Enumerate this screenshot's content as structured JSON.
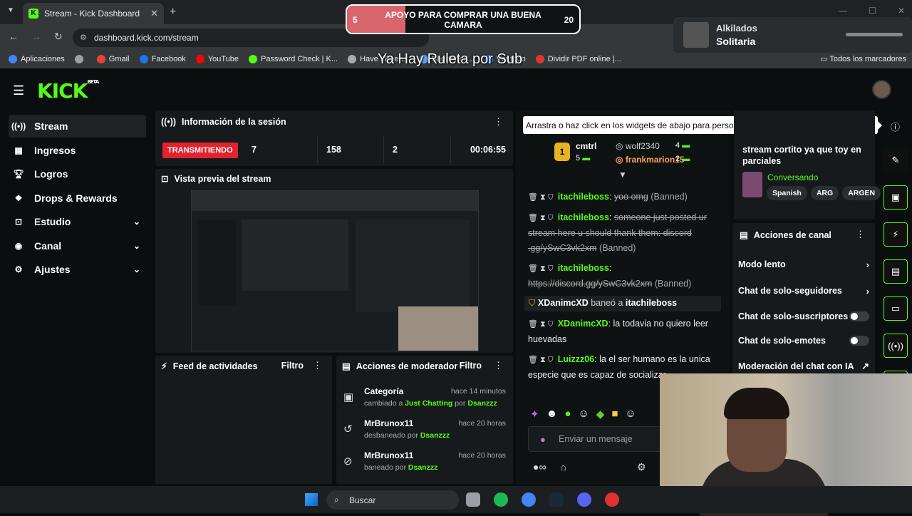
{
  "browser": {
    "tab_title": "Stream - Kick Dashboard",
    "url": "dashboard.kick.com/stream",
    "bookmarks": [
      {
        "label": "Aplicaciones",
        "color": "#4285f4"
      },
      {
        "label": "",
        "color": "#9aa0a6"
      },
      {
        "label": "Gmail",
        "color": "#ea4335"
      },
      {
        "label": "Facebook",
        "color": "#1877f2"
      },
      {
        "label": "YouTube",
        "color": "#ff0000"
      },
      {
        "label": "Password Check | K...",
        "color": "#53fc18"
      },
      {
        "label": "Have I Been...",
        "color": "#aaaaaa"
      },
      {
        "label": "Shortened...",
        "color": "#5fa0ff"
      },
      {
        "label": "Ver todo",
        "color": "#1877f2"
      },
      {
        "label": "Dividir PDF online |...",
        "color": "#e5322d"
      }
    ],
    "all_bookmarks": "Todos los marcadores"
  },
  "overlay": {
    "goal_left": "5",
    "goal_text": "APOYO PARA COMPRAR UNA BUENA CAMARA",
    "goal_right": "20",
    "goal_progress": 0.25,
    "ruleta": "Ya Hay Ruleta por Sub",
    "spotify_line1": "Alkilados",
    "spotify_line2": "Solitaria"
  },
  "sidebar": {
    "items": [
      {
        "label": "Stream",
        "icon": "stream-icon",
        "glyph": "((•))",
        "active": true
      },
      {
        "label": "Ingresos",
        "icon": "revenue-icon",
        "glyph": "▦"
      },
      {
        "label": "Logros",
        "icon": "trophy-icon",
        "glyph": "🏆︎"
      },
      {
        "label": "Drops & Rewards",
        "icon": "gift-icon",
        "glyph": "❖"
      },
      {
        "label": "Estudio",
        "icon": "studio-icon",
        "glyph": "⊡",
        "chevron": true
      },
      {
        "label": "Canal",
        "icon": "channel-icon",
        "glyph": "◉",
        "chevron": true
      },
      {
        "label": "Ajustes",
        "icon": "settings-icon",
        "glyph": "⚙",
        "chevron": true
      }
    ]
  },
  "session": {
    "title": "Información de la sesión",
    "status": "TRANSMITIENDO",
    "stats": [
      "7",
      "158",
      "2",
      "00:06:55"
    ]
  },
  "preview": {
    "title": "Vista previa del stream"
  },
  "feed": {
    "title": "Feed de actividades",
    "filter": "Filtro"
  },
  "mod_actions": {
    "title": "Acciones de moderador",
    "filter": "Filtro",
    "items": [
      {
        "icon": "category-icon",
        "glyph": "▣",
        "title": "Categoría",
        "time": "hace 14 minutos",
        "pre": "cambiado a ",
        "hl": "Just Chatting",
        "mid": " por ",
        "by": "Dsanzzz"
      },
      {
        "icon": "unban-icon",
        "glyph": "↺",
        "title": "MrBrunox11",
        "time": "hace 20 horas",
        "pre": "desbaneado por ",
        "hl": "",
        "mid": "",
        "by": "Dsanzzz"
      },
      {
        "icon": "ban-icon",
        "glyph": "⊘",
        "title": "MrBrunox11",
        "time": "hace 20 horas",
        "pre": "baneado por ",
        "hl": "",
        "mid": "",
        "by": "Dsanzzz"
      }
    ]
  },
  "tooltip": "Arrastra o haz click en los widgets de abajo para personalizar tu propio panel de control",
  "leaderboard": {
    "medal": "1",
    "first_name": "cmtrl",
    "first_count": "5",
    "second_name": "wolf2340",
    "second_count": "4",
    "third_name": "frankmarion15",
    "third_count": "2"
  },
  "chat": {
    "messages": [
      {
        "user": "itachileboss",
        "user_color": "#53fc18",
        "text": "yoo omg",
        "deleted": true,
        "suffix": "(Banned)"
      },
      {
        "user": "itachileboss",
        "user_color": "#53fc18",
        "text": "someone just posted ur stream here u should thank them: discord .gg/ySwC3vk2xm",
        "deleted": true,
        "suffix": "(Banned)"
      },
      {
        "user": "itachileboss",
        "user_color": "#53fc18",
        "text": "https://discord.gg/ySwC3vk2xm",
        "deleted": true,
        "suffix": "(Banned)"
      }
    ],
    "ban_notice": {
      "actor": "XDanimcXD",
      "verb": "baneó a",
      "target": "itachileboss"
    },
    "messages2": [
      {
        "user": "XDanimcXD",
        "user_color": "#53fc18",
        "text": "la todavia no quiero leer huevadas"
      },
      {
        "user": "Luizzz06",
        "user_color": "#53fc18",
        "text": "la el ser humano es la unica especie que es capaz de socializar"
      }
    ],
    "input_placeholder": "Enviar un mensaje"
  },
  "stream_info": {
    "title": "stream cortito ya que toy en parciales",
    "category": "Conversando",
    "tags": [
      "Spanish",
      "ARG",
      "ARGEN"
    ]
  },
  "channel_actions": {
    "title": "Acciones de canal",
    "rows": [
      {
        "label": "Modo lento",
        "type": "chevron"
      },
      {
        "label": "Chat de solo-seguidores",
        "type": "chevron"
      },
      {
        "label": "Chat de solo-suscriptores",
        "type": "toggle",
        "on": false
      },
      {
        "label": "Chat de solo-emotes",
        "type": "toggle",
        "on": false
      },
      {
        "label": "Moderación del chat con IA",
        "type": "link"
      }
    ]
  },
  "taskbar": {
    "search": "Buscar"
  }
}
